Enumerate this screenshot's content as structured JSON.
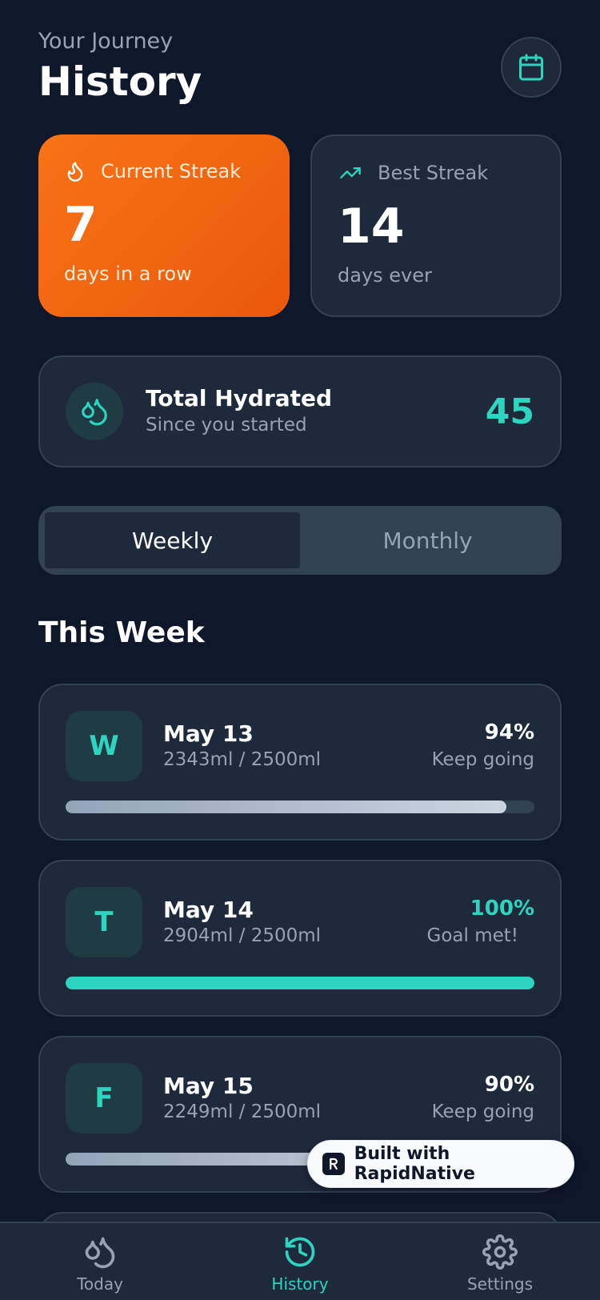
{
  "header": {
    "subtitle": "Your Journey",
    "title": "History"
  },
  "streaks": {
    "current": {
      "label": "Current Streak",
      "value": "7",
      "unit": "days in a row"
    },
    "best": {
      "label": "Best Streak",
      "value": "14",
      "unit": "days ever"
    }
  },
  "total": {
    "title": "Total Hydrated",
    "subtitle": "Since you started",
    "value": "45"
  },
  "segment": {
    "weekly": "Weekly",
    "monthly": "Monthly",
    "selected": "Weekly"
  },
  "section_title": "This Week",
  "days": [
    {
      "letter": "W",
      "date": "May 13",
      "amount": "2343ml / 2500ml",
      "percent": "94%",
      "status": "Keep going",
      "progress": 0.94
    },
    {
      "letter": "T",
      "date": "May 14",
      "amount": "2904ml / 2500ml",
      "percent": "100%",
      "status": "Goal met!",
      "progress": 1.0
    },
    {
      "letter": "F",
      "date": "May 15",
      "amount": "2249ml / 2500ml",
      "percent": "90%",
      "status": "Keep going",
      "progress": 0.9
    }
  ],
  "badge": {
    "text": "Built with RapidNative"
  },
  "tabs": [
    {
      "label": "Today",
      "icon": "water-drops-icon"
    },
    {
      "label": "History",
      "icon": "history-icon"
    },
    {
      "label": "Settings",
      "icon": "gear-icon"
    }
  ],
  "colors": {
    "background": "#0f172a",
    "card": "#1e293b",
    "accent": "#2dd4bf",
    "streak": "#f97316"
  }
}
